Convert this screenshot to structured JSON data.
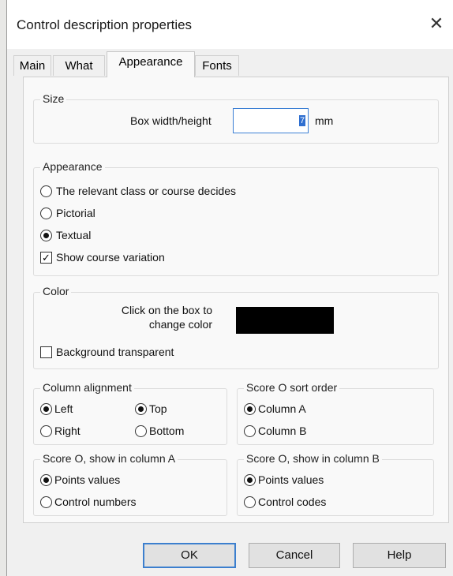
{
  "window": {
    "title": "Control description properties",
    "close_glyph": "✕"
  },
  "tabs": [
    "Main",
    "What",
    "Appearance",
    "Fonts"
  ],
  "size": {
    "legend": "Size",
    "box_label": "Box width/height",
    "box_value": "7",
    "unit": "mm"
  },
  "appearance": {
    "legend": "Appearance",
    "options": [
      "The relevant class or course decides",
      "Pictorial",
      "Textual"
    ],
    "selected": "Textual",
    "show_variation": {
      "label": "Show course variation",
      "checked": true
    }
  },
  "color": {
    "legend": "Color",
    "hint_line1": "Click on the box to",
    "hint_line2": "change color",
    "swatch": "#000000",
    "background_transparent": {
      "label": "Background transparent",
      "checked": false
    }
  },
  "column_alignment": {
    "legend": "Column alignment",
    "left": "Left",
    "right": "Right",
    "top": "Top",
    "bottom": "Bottom",
    "selected_horizontal": "Left",
    "selected_vertical": "Top"
  },
  "score_sort": {
    "legend": "Score O sort order",
    "column_a": "Column A",
    "column_b": "Column B",
    "selected": "Column A"
  },
  "score_col_a": {
    "legend": "Score O, show in column A",
    "points": "Points values",
    "control_numbers": "Control numbers",
    "selected": "Points values"
  },
  "score_col_b": {
    "legend": "Score O, show in column B",
    "points": "Points values",
    "control_codes": "Control codes",
    "selected": "Points values"
  },
  "buttons": {
    "ok": "OK",
    "cancel": "Cancel",
    "help": "Help"
  },
  "colors": {
    "accent": "#3c7fce",
    "panel": "#f9f9f9",
    "dialog": "#f0f0f0"
  }
}
